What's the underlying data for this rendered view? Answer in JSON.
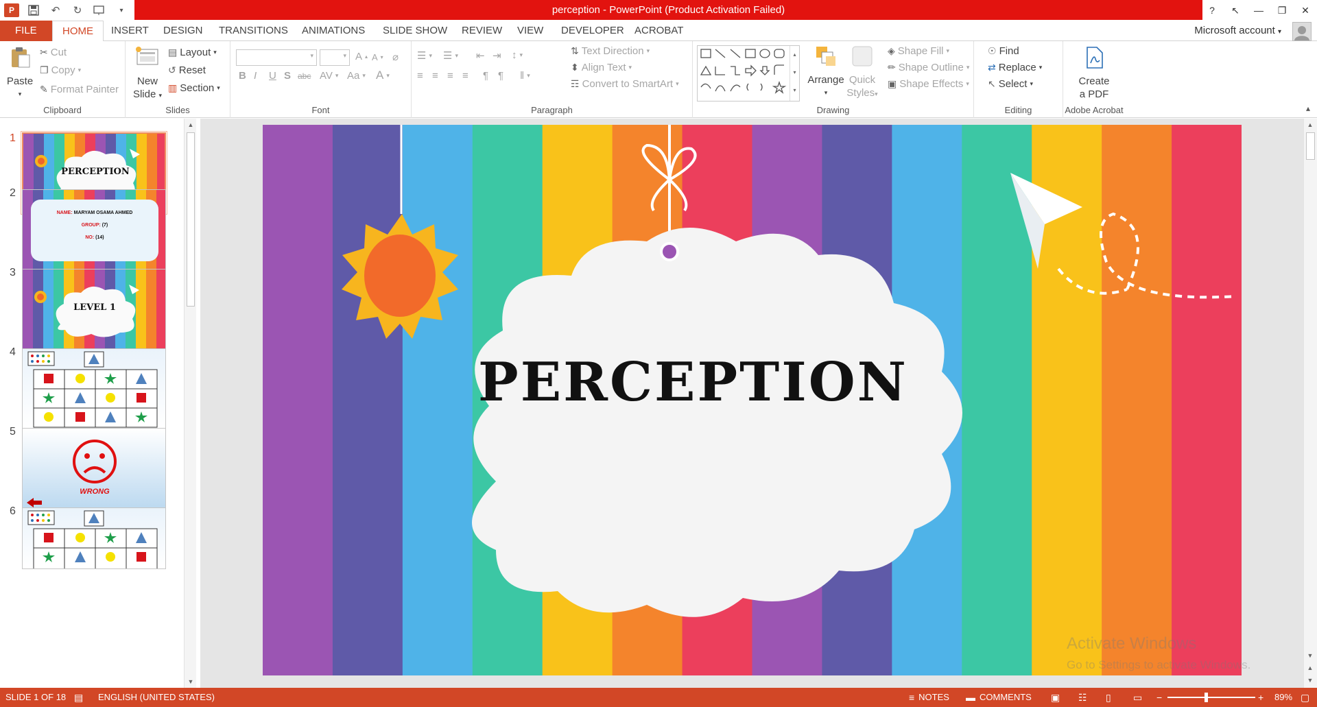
{
  "window": {
    "title": "perception -  PowerPoint (Product Activation Failed)",
    "help": "?",
    "controls": [
      "↖",
      "—",
      "❐",
      "✕"
    ]
  },
  "qat": {
    "save_icon": "save-icon",
    "undo_icon": "undo-icon",
    "redo_icon": "redo-icon",
    "present_icon": "start-from-beginning-icon"
  },
  "tabs": [
    "FILE",
    "HOME",
    "INSERT",
    "DESIGN",
    "TRANSITIONS",
    "ANIMATIONS",
    "SLIDE SHOW",
    "REVIEW",
    "VIEW",
    "DEVELOPER",
    "ACROBAT"
  ],
  "active_tab": "HOME",
  "account": "Microsoft account",
  "ribbon": {
    "clipboard": {
      "label": "Clipboard",
      "paste": "Paste",
      "cut": "Cut",
      "copy": "Copy",
      "format_painter": "Format Painter"
    },
    "slides": {
      "label": "Slides",
      "new_slide_1": "New",
      "new_slide_2": "Slide",
      "layout": "Layout",
      "reset": "Reset",
      "section": "Section"
    },
    "font": {
      "label": "Font",
      "bold": "B",
      "italic": "I",
      "underline": "U",
      "shadow": "S",
      "strike": "abc",
      "spacing": "AV",
      "case": "Aa",
      "color": "A",
      "grow": "A",
      "shrink": "A"
    },
    "paragraph": {
      "label": "Paragraph",
      "text_direction": "Text Direction",
      "align_text": "Align Text",
      "convert_smartart": "Convert to SmartArt"
    },
    "drawing": {
      "label": "Drawing",
      "arrange": "Arrange",
      "quick_styles_1": "Quick",
      "quick_styles_2": "Styles",
      "shape_fill": "Shape Fill",
      "shape_outline": "Shape Outline",
      "shape_effects": "Shape Effects"
    },
    "editing": {
      "label": "Editing",
      "find": "Find",
      "replace": "Replace",
      "select": "Select"
    },
    "acrobat": {
      "label": "Adobe Acrobat",
      "create_1": "Create",
      "create_2": "a PDF"
    }
  },
  "thumbnails": [
    {
      "num": "1",
      "title": "PERCEPTION"
    },
    {
      "num": "2",
      "name_label": "NAME:",
      "name_value": "MARYAM OSAMA AHMED",
      "group_label": "GROUP:",
      "group_value": "(7)",
      "no_label": "NO:",
      "no_value": "(14)"
    },
    {
      "num": "3",
      "title": "LEVEL 1"
    },
    {
      "num": "4"
    },
    {
      "num": "5",
      "text": "WRONG"
    },
    {
      "num": "6"
    }
  ],
  "slide": {
    "title": "PERCEPTION"
  },
  "watermark": {
    "line1": "Activate Windows",
    "line2": "Go to Settings to activate Windows."
  },
  "status": {
    "slide_of": "SLIDE 1 OF 18",
    "language": "ENGLISH (UNITED STATES)",
    "notes": "NOTES",
    "comments": "COMMENTS",
    "zoom": "89%"
  },
  "colors": {
    "accent": "#d24726",
    "title_bar": "#e2130f",
    "stripes": [
      "#9b55b3",
      "#5f5aa8",
      "#4fb3e8",
      "#3cc7a4",
      "#f9c21a",
      "#f4842c",
      "#ec3f5c",
      "#9b55b3",
      "#5f5aa8",
      "#4fb3e8",
      "#3cc7a4",
      "#f9c21a",
      "#f4842c",
      "#ec3f5c"
    ]
  }
}
